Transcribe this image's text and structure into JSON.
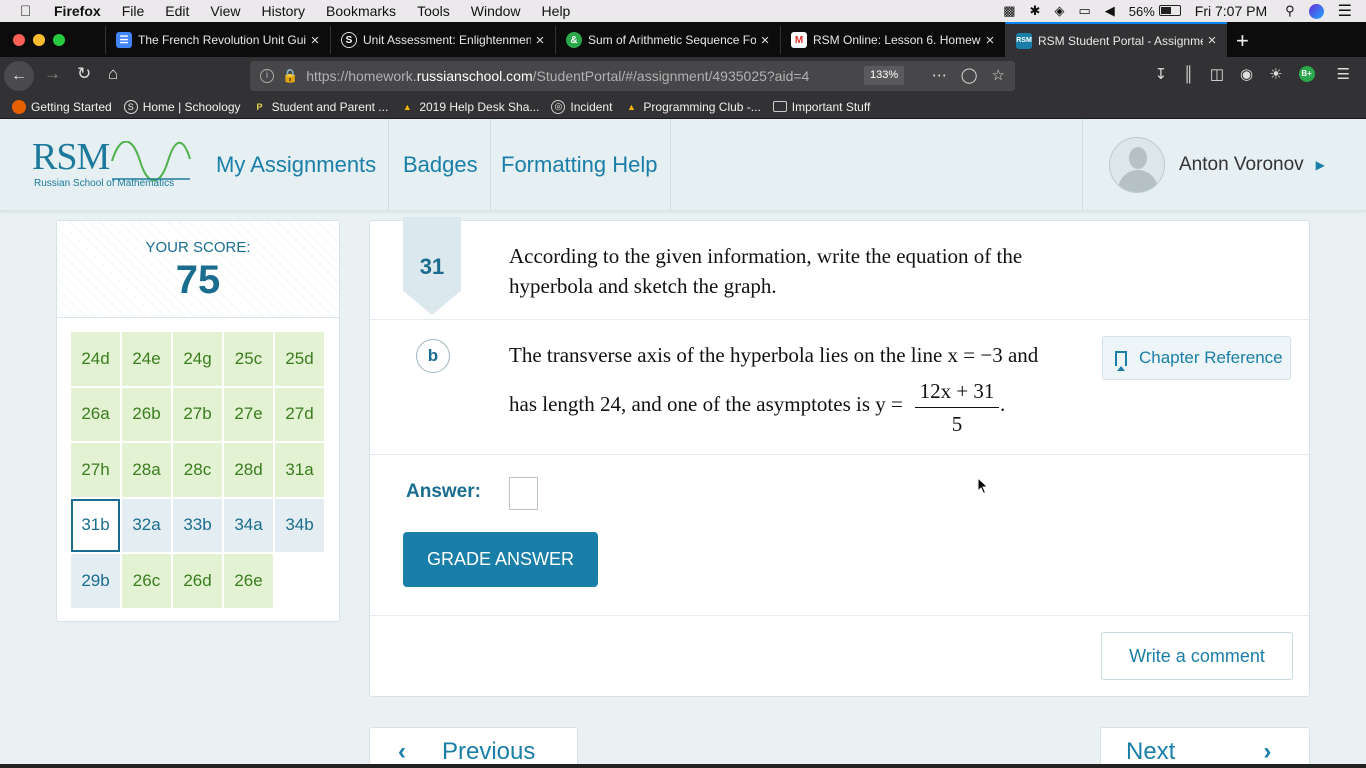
{
  "menubar": {
    "app": "Firefox",
    "menus": [
      "File",
      "Edit",
      "View",
      "History",
      "Bookmarks",
      "Tools",
      "Window",
      "Help"
    ],
    "battery": "56%",
    "clock": "Fri 7:07 PM"
  },
  "tabs": [
    {
      "title": "The French Revolution Unit Gui",
      "favicon_color": "#4285f4",
      "favicon": "docs-icon"
    },
    {
      "title": "Unit Assessment: Enlightenmen",
      "favicon_color": "#333",
      "favicon": "schoology-icon"
    },
    {
      "title": "Sum of Arithmetic Sequence Fo",
      "favicon_color": "#2aa84b",
      "favicon": "desmos-icon"
    },
    {
      "title": "RSM Online: Lesson 6. Homewo",
      "favicon_color": "#d93025",
      "favicon": "gmail-icon"
    },
    {
      "title": "RSM Student Portal - Assignme",
      "favicon_color": "#1a7fa8",
      "favicon": "rsm-icon"
    }
  ],
  "url": {
    "prefix": "https://homework.",
    "domain": "russianschool.com",
    "rest": "/StudentPortal/#/assignment/4935025?aid=4",
    "zoom": "133%"
  },
  "bookmarks": [
    "Getting Started",
    "Home | Schoology",
    "Student and Parent ...",
    "2019 Help Desk Sha...",
    "Incident",
    "Programming Club -...",
    "Important Stuff"
  ],
  "header": {
    "logo_text": "RSM",
    "logo_sub": "Russian School of Mathematics",
    "nav": [
      "My Assignments",
      "Badges",
      "Formatting Help"
    ],
    "user_name": "Anton Voronov"
  },
  "score": {
    "label": "YOUR SCORE:",
    "value": "75",
    "items": [
      {
        "label": "24d",
        "state": "done"
      },
      {
        "label": "24e",
        "state": "done"
      },
      {
        "label": "24g",
        "state": "done"
      },
      {
        "label": "25c",
        "state": "done"
      },
      {
        "label": "25d",
        "state": "done"
      },
      {
        "label": "26a",
        "state": "done"
      },
      {
        "label": "26b",
        "state": "done"
      },
      {
        "label": "27b",
        "state": "done"
      },
      {
        "label": "27e",
        "state": "done"
      },
      {
        "label": "27d",
        "state": "done"
      },
      {
        "label": "27h",
        "state": "done"
      },
      {
        "label": "28a",
        "state": "done"
      },
      {
        "label": "28c",
        "state": "done"
      },
      {
        "label": "28d",
        "state": "done"
      },
      {
        "label": "31a",
        "state": "done"
      },
      {
        "label": "31b",
        "state": "current"
      },
      {
        "label": "32a",
        "state": "todo"
      },
      {
        "label": "33b",
        "state": "todo"
      },
      {
        "label": "34a",
        "state": "todo"
      },
      {
        "label": "34b",
        "state": "todo"
      },
      {
        "label": "29b",
        "state": "todo"
      },
      {
        "label": "26c",
        "state": "done"
      },
      {
        "label": "26d",
        "state": "done"
      },
      {
        "label": "26e",
        "state": "done"
      }
    ]
  },
  "question": {
    "number": "31",
    "text": "According to the given information, write the equation of the hyperbola and sketch the graph.",
    "part": "b",
    "line1": "The transverse axis of the hyperbola lies on the line x = −3 and",
    "line2": "has length 24,  and one of the asymptotes is y =",
    "frac_num": "12x + 31",
    "frac_den": "5",
    "chapter_ref": "Chapter Reference",
    "answer_label": "Answer:",
    "grade_button": "GRADE ANSWER",
    "comment_button": "Write a comment"
  },
  "pager": {
    "prev": "Previous",
    "next": "Next"
  }
}
